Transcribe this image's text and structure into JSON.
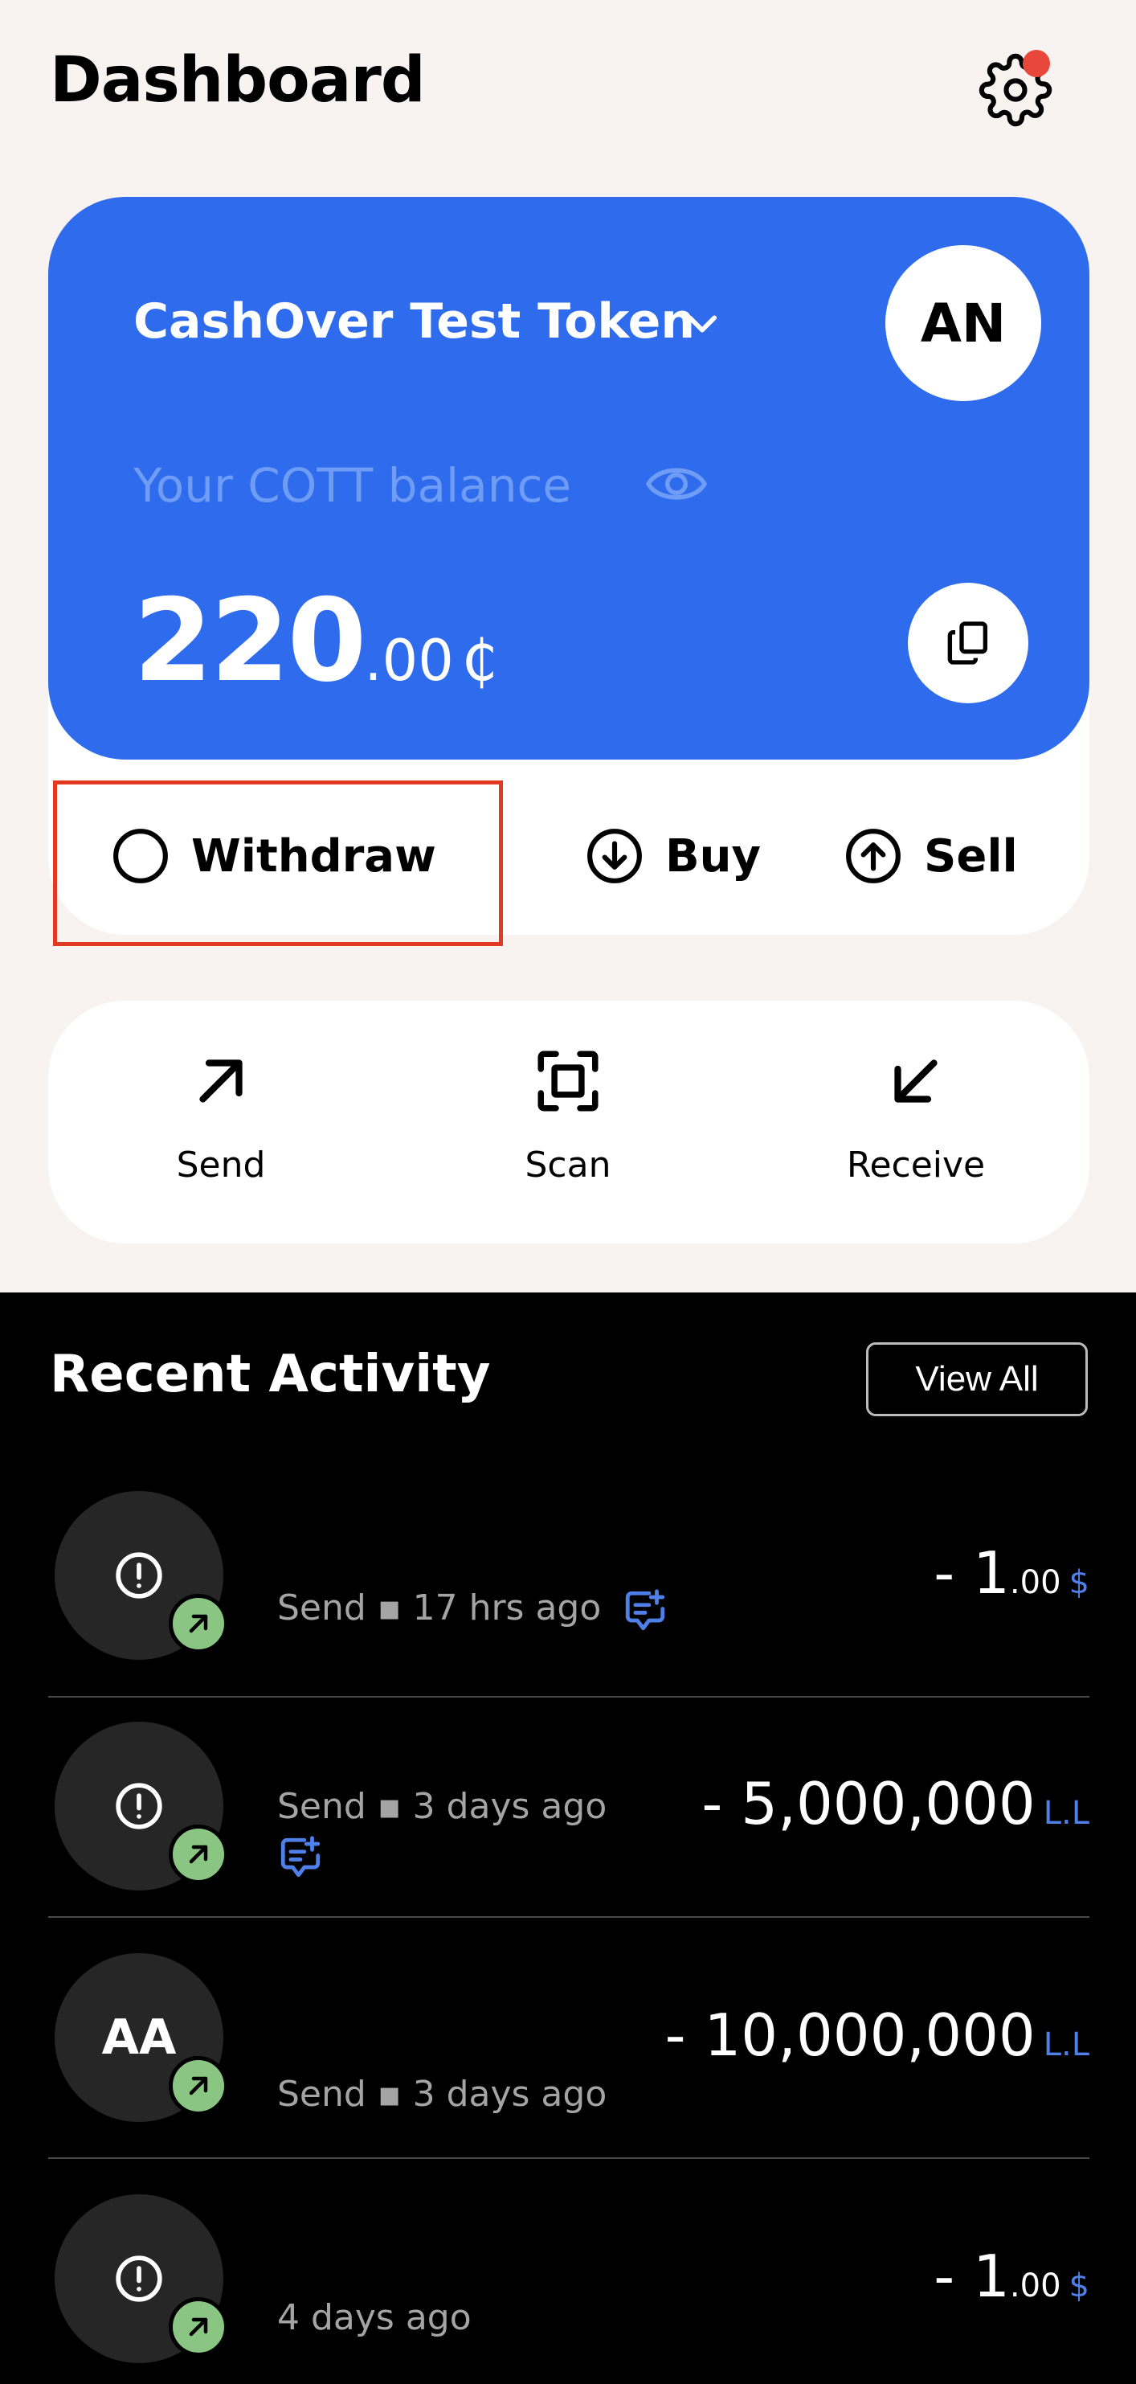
{
  "header": {
    "title": "Dashboard",
    "settings_icon": "gear-icon",
    "notification_color": "#e8473b"
  },
  "wallet": {
    "token_name": "CashOver Test Token",
    "avatar_initials": "AN",
    "balance_label": "Your COTT balance",
    "balance_int": "220",
    "balance_dec": ".00",
    "balance_currency": "₵",
    "accent_color": "#2f6ced"
  },
  "actions": [
    {
      "label": "Withdraw",
      "icon": "circle-icon"
    },
    {
      "label": "Buy",
      "icon": "arrow-down-circle-icon"
    },
    {
      "label": "Sell",
      "icon": "arrow-up-circle-icon"
    }
  ],
  "quick_actions": [
    {
      "label": "Send",
      "icon": "arrow-up-right-icon"
    },
    {
      "label": "Scan",
      "icon": "scan-icon"
    },
    {
      "label": "Receive",
      "icon": "arrow-down-left-icon"
    }
  ],
  "recent": {
    "title": "Recent Activity",
    "view_all": "View All",
    "items": [
      {
        "avatar": "!",
        "meta": "Send ▪ 17 hrs ago",
        "amount_int": "- 1",
        "amount_dec": ".00",
        "currency": "$"
      },
      {
        "avatar": "!",
        "meta": "Send ▪ 3 days ago",
        "amount_int": "- 5,000,000",
        "amount_dec": "",
        "currency": "L.L"
      },
      {
        "avatar": "AA",
        "meta": "Send ▪ 3 days ago",
        "amount_int": "- 10,000,000",
        "amount_dec": "",
        "currency": "L.L"
      },
      {
        "avatar": "!",
        "meta": "4 days ago",
        "amount_int": "- 1",
        "amount_dec": ".00",
        "currency": "$"
      }
    ]
  }
}
